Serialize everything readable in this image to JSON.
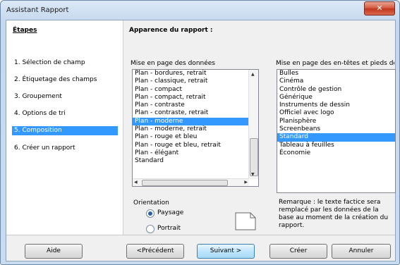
{
  "window": {
    "title": "Assistant Rapport",
    "close_glyph": "✕"
  },
  "steps": {
    "title": "Étapes",
    "items": [
      {
        "label": "1.  Sélection de champ"
      },
      {
        "label": "2.  Étiquetage des champs"
      },
      {
        "label": "3.  Groupement"
      },
      {
        "label": "4.  Options de tri"
      },
      {
        "label": "5.  Composition",
        "selected": true
      },
      {
        "label": "6.  Créer un rapport"
      }
    ]
  },
  "main": {
    "title": "Apparence du rapport :",
    "data_layout_label": "Mise en page des données",
    "header_layout_label": "Mise en page des en-têtes et pieds de p",
    "data_layouts": [
      "Plan - bordures, retrait",
      "Plan - classique, retrait",
      "Plan - compact",
      "Plan - compact, retrait",
      "Plan - contraste",
      "Plan - contraste, retrait",
      "Plan - moderne",
      "Plan - moderne, retrait",
      "Plan - rouge et bleu",
      "Plan - rouge et bleu, retrait",
      "Plan - élégant",
      "Standard"
    ],
    "data_layout_selected": "Plan - moderne",
    "header_layouts": [
      "Bulles",
      "Cinéma",
      "Contrôle de gestion",
      "Générique",
      "Instruments de dessin",
      "Officiel avec logo",
      "Planisphère",
      "Screenbeans",
      "Standard",
      "Tableau à feuilles",
      "Économie"
    ],
    "header_layout_selected": "Standard",
    "orientation": {
      "label": "Orientation",
      "landscape": "Paysage",
      "portrait": "Portrait",
      "selected": "landscape"
    },
    "note": "Remarque : le texte factice sera remplacé par les données de la base au moment de la création du rapport."
  },
  "buttons": {
    "help": "Aide",
    "previous": "<Précédent",
    "next": "Suivant >",
    "create": "Créer",
    "cancel": "Annuler"
  },
  "colors": {
    "selection": "#3399ff",
    "close_button": "#c0361c"
  }
}
